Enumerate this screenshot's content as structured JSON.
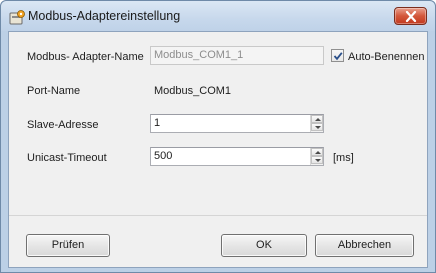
{
  "window": {
    "title": "Modbus-Adaptereinstellung",
    "icon": "modbus-adapter-icon",
    "close_icon": "close-icon",
    "close_color": "#c2391e"
  },
  "form": {
    "adapter_name": {
      "label": "Modbus- Adapter-Name",
      "value": "Modbus_COM1_1",
      "disabled": true
    },
    "auto_rename": {
      "label": "Auto-Benennen",
      "checked": true
    },
    "port_name": {
      "label": "Port-Name",
      "value": "Modbus_COM1"
    },
    "slave_address": {
      "label": "Slave-Adresse",
      "value": "1"
    },
    "unicast_timeout": {
      "label": "Unicast-Timeout",
      "value": "500",
      "unit": "[ms]"
    }
  },
  "buttons": {
    "check": "Prüfen",
    "ok": "OK",
    "cancel": "Abbrechen"
  }
}
